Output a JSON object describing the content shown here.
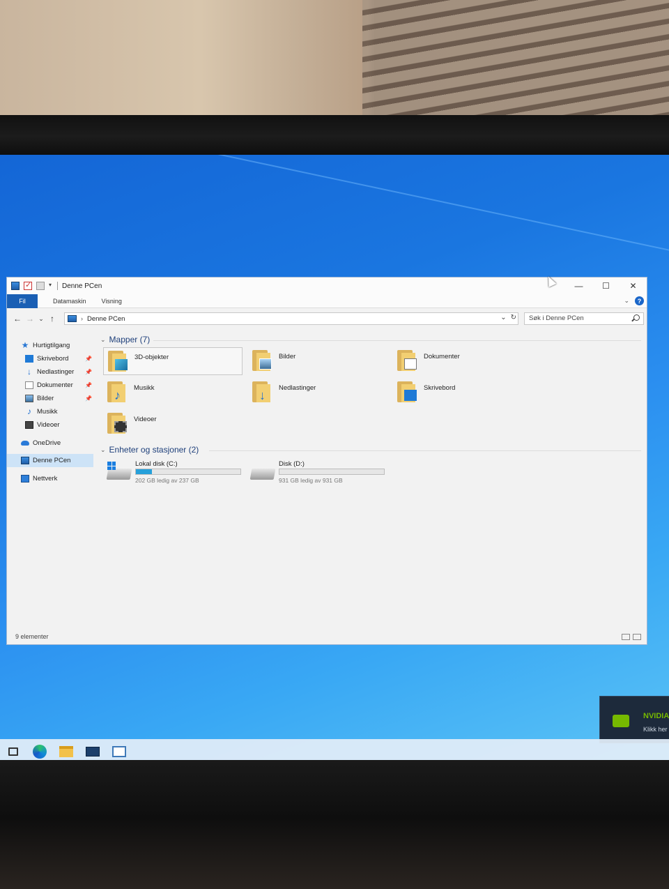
{
  "window": {
    "title": "Denne PCen",
    "controls": {
      "minimize": "—",
      "maximize": "☐",
      "close": "✕"
    }
  },
  "ribbon": {
    "tabs": [
      "Fil",
      "Datamaskin",
      "Visning"
    ],
    "help": "?",
    "expand": "⌄"
  },
  "navigation": {
    "back": "←",
    "forward": "→",
    "recent": "⌄",
    "up": "↑",
    "breadcrumb_sep": "›",
    "address": "Denne PCen",
    "address_dropdown": "⌄",
    "refresh": "↻",
    "search_placeholder": "Søk i Denne PCen"
  },
  "sidebar": {
    "quick_access": "Hurtigtilgang",
    "quick_items": [
      "Skrivebord",
      "Nedlastinger",
      "Dokumenter",
      "Bilder",
      "Musikk",
      "Videoer"
    ],
    "pinned_marker": "📌",
    "onedrive": "OneDrive",
    "this_pc": "Denne PCen",
    "network": "Nettverk"
  },
  "content": {
    "folders_group": "Mapper (7)",
    "folders": [
      "3D-objekter",
      "Bilder",
      "Dokumenter",
      "Musikk",
      "Nedlastinger",
      "Skrivebord",
      "Videoer"
    ],
    "drives_group": "Enheter og stasjoner (2)",
    "drives": [
      {
        "name": "Lokal disk (C:)",
        "free": "202 GB ledig av 237 GB",
        "used_fraction": 0.15
      },
      {
        "name": "Disk (D:)",
        "free": "931 GB ledig av 931 GB",
        "used_fraction": 0.0
      }
    ]
  },
  "status": {
    "items": "9 elementer"
  },
  "toast": {
    "title": "NVIDIA",
    "subtitle": "Klikk her f"
  },
  "colors": {
    "accent": "#1a5fb4",
    "drive_fill": "#26a0da",
    "nvidia": "#76b900"
  }
}
